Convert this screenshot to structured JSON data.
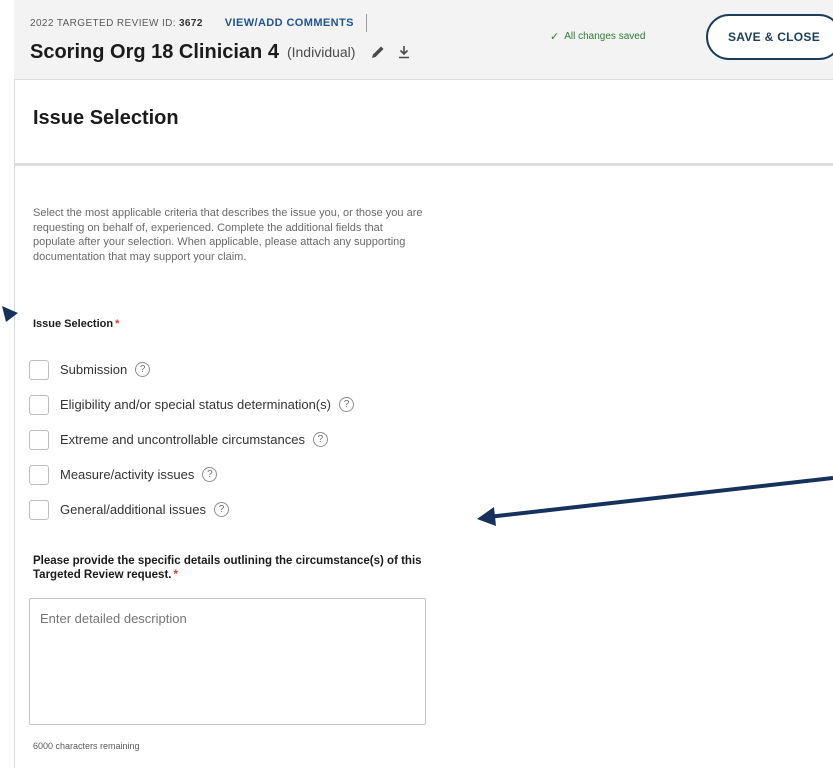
{
  "header": {
    "review_label": "2022 TARGETED REVIEW ID:",
    "review_id": "3672",
    "view_comments_label": "VIEW/ADD COMMENTS",
    "entity_name": "Scoring Org 18 Clinician 4",
    "entity_type": "(Individual)",
    "saved_status": "All changes saved",
    "save_close_label": "SAVE & CLOSE"
  },
  "section": {
    "title": "Issue Selection"
  },
  "form": {
    "intro": "Select the most applicable criteria that describes the issue you, or those you are requesting on behalf of, experienced. Complete the additional fields that populate after your selection. When applicable, please attach any supporting documentation that may support your claim.",
    "issue_label": "Issue Selection",
    "required_mark": "*",
    "options": [
      {
        "label": "Submission",
        "checked": false
      },
      {
        "label": "Eligibility and/or special status determination(s)",
        "checked": false
      },
      {
        "label": "Extreme and uncontrollable circumstances",
        "checked": false
      },
      {
        "label": "Measure/activity issues",
        "checked": false
      },
      {
        "label": "General/additional issues",
        "checked": false
      }
    ],
    "details_label": "Please provide the specific details outlining the circumstance(s) of this Targeted Review request.",
    "details_placeholder": "Enter detailed description",
    "details_value": "",
    "chars_remaining": "6000 characters remaining"
  },
  "colors": {
    "accent": "#205493",
    "arrow": "#16325c",
    "success": "#2e7d32",
    "required": "#d83933"
  }
}
